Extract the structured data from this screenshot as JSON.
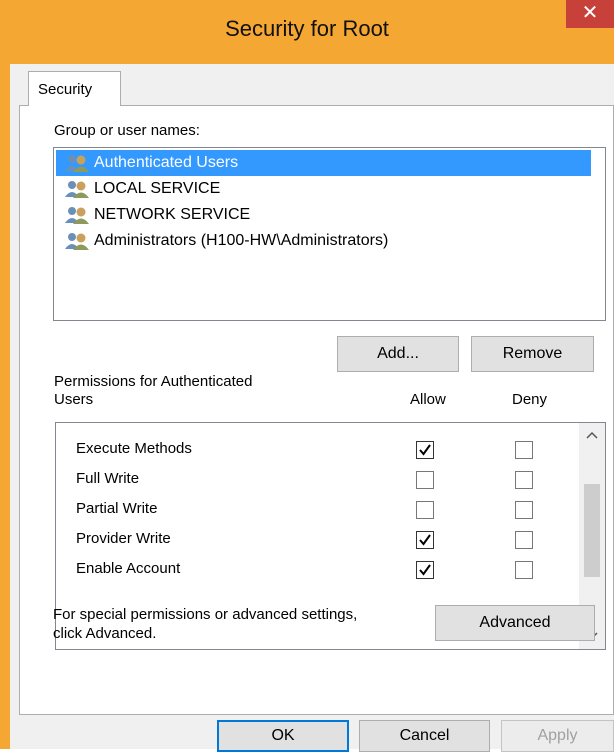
{
  "window": {
    "title": "Security for Root",
    "close_glyph": "✕"
  },
  "tab": {
    "label": "Security"
  },
  "groups": {
    "label": "Group or user names:",
    "users": [
      {
        "name": "Authenticated Users",
        "selected": true,
        "icon": "users-group-icon"
      },
      {
        "name": "LOCAL SERVICE",
        "selected": false,
        "icon": "users-group-icon"
      },
      {
        "name": "NETWORK SERVICE",
        "selected": false,
        "icon": "users-group-icon"
      },
      {
        "name": "Administrators (H100-HW\\Administrators)",
        "selected": false,
        "icon": "users-group-icon"
      }
    ],
    "add_label": "Add...",
    "remove_label": "Remove"
  },
  "permissions": {
    "header_line1": "Permissions for Authenticated",
    "header_line2": "Users",
    "allow_label": "Allow",
    "deny_label": "Deny",
    "rows": [
      {
        "name": "Execute Methods",
        "allow": true,
        "deny": false
      },
      {
        "name": "Full Write",
        "allow": false,
        "deny": false
      },
      {
        "name": "Partial Write",
        "allow": false,
        "deny": false
      },
      {
        "name": "Provider Write",
        "allow": true,
        "deny": false
      },
      {
        "name": "Enable Account",
        "allow": true,
        "deny": false
      }
    ]
  },
  "advanced": {
    "text_line1": "For special permissions or advanced settings,",
    "text_line2": "click Advanced.",
    "button_label": "Advanced"
  },
  "footer": {
    "ok_label": "OK",
    "cancel_label": "Cancel",
    "apply_label": "Apply"
  },
  "colors": {
    "title_bar": "#f5a733",
    "close_button": "#c7403a",
    "selection": "#3399ff",
    "default_button_border": "#0078d7"
  }
}
